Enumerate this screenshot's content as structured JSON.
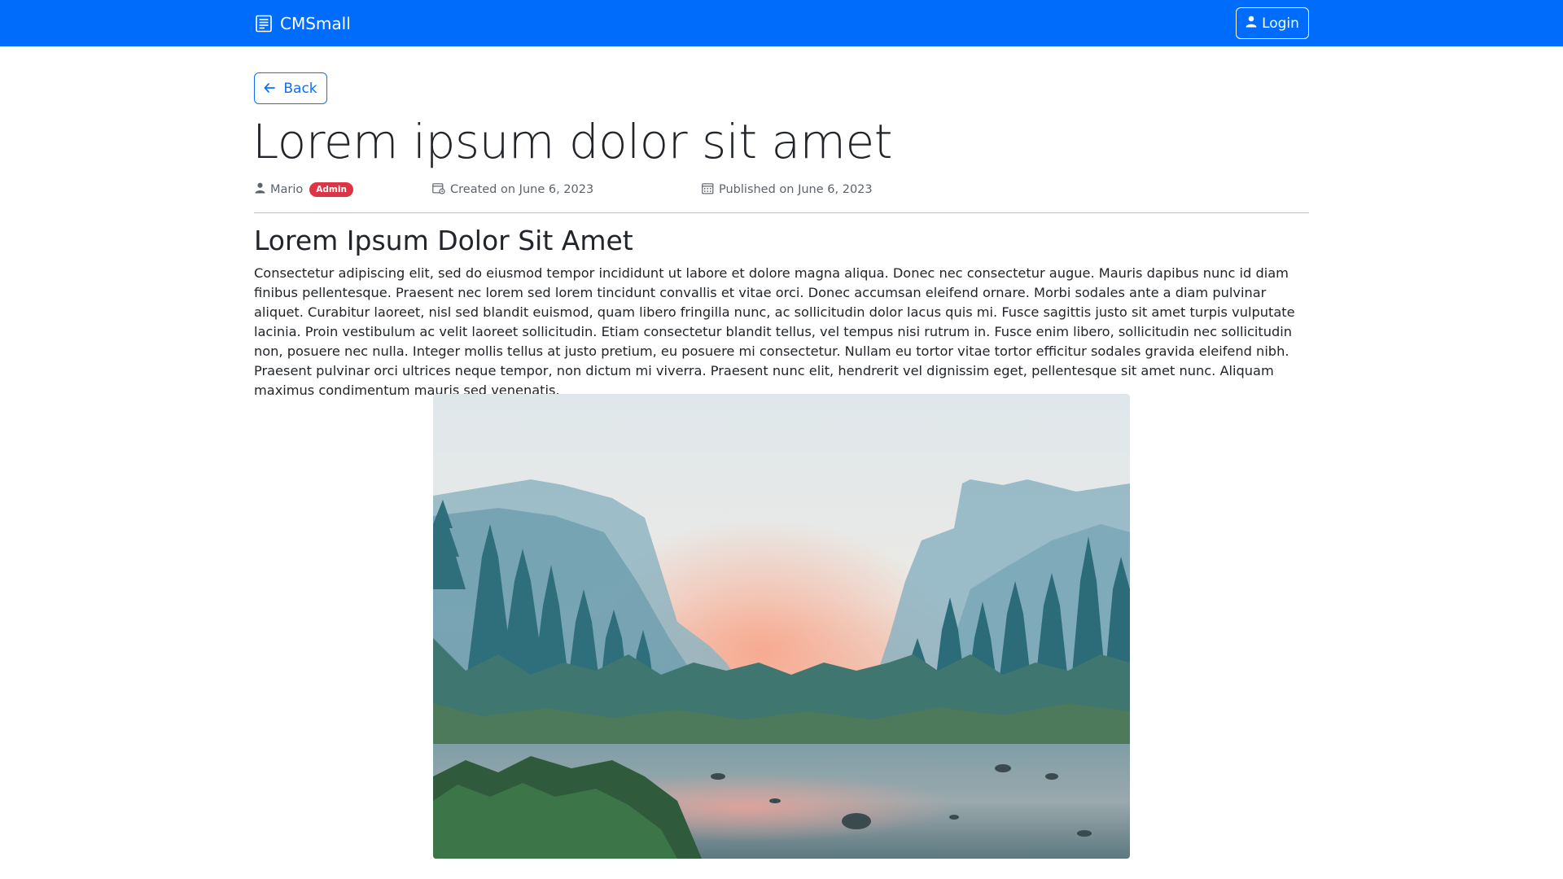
{
  "navbar": {
    "brand_label": "CMSmall",
    "brand_icon": "newspaper-icon",
    "login_label": "Login",
    "login_icon": "person-icon",
    "background": "#006cfb"
  },
  "back_button": {
    "label": "Back",
    "icon": "arrow-left-icon",
    "color": "#0d6efd"
  },
  "post": {
    "title": "Lorem ipsum dolor sit amet",
    "author": "Mario",
    "author_icon": "person-icon",
    "role_badge": "Admin",
    "badge_color": "#dc3545",
    "created": "Created on June 6, 2023",
    "created_icon": "calendar-clock-icon",
    "published": "Published on June 6, 2023",
    "published_icon": "calendar-icon",
    "section_heading": "Lorem Ipsum Dolor Sit Amet",
    "paragraph": "Consectetur adipiscing elit, sed do eiusmod tempor incididunt ut labore et dolore magna aliqua. Donec nec consectetur augue. Mauris dapibus nunc id diam finibus pellentesque. Praesent nec lorem sed lorem tincidunt convallis et vitae orci. Donec accumsan eleifend ornare. Morbi sodales ante a diam pulvinar aliquet. Curabitur laoreet, nisl sed blandit euismod, quam libero fringilla nunc, ac sollicitudin dolor lacus quis mi. Fusce sagittis justo sit amet turpis vulputate lacinia. Proin vestibulum ac velit laoreet sollicitudin. Etiam consectetur blandit tellus, vel tempus nisi rutrum in. Fusce enim libero, sollicitudin nec sollicitudin non, posuere nec nulla. Integer mollis tellus at justo pretium, eu posuere mi consectetur. Nullam eu tortor vitae tortor efficitur sodales gravida eleifend nibh. Praesent pulvinar orci ultrices neque tempor, non dictum mi viverra. Praesent nunc elit, hendrerit vel dignissim eget, pellentesque sit amet nunc. Aliquam maximus condimentum mauris sed venenatis.",
    "image_subject": "landscape-photo"
  }
}
